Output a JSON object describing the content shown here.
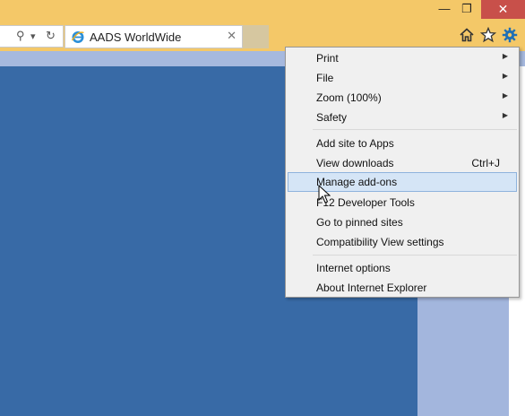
{
  "tab": {
    "title": "AADS WorldWide",
    "close": "✕"
  },
  "address": {
    "search_glyph": "⚲",
    "dropdown_glyph": "▾",
    "refresh_glyph": "↻"
  },
  "window": {
    "minimize": "—",
    "restore": "❐",
    "close": "✕"
  },
  "toolbar": {
    "icons": [
      "home-icon",
      "favorites-star-icon",
      "tools-gear-icon"
    ]
  },
  "menu": {
    "print": "Print",
    "file": "File",
    "zoom": "Zoom (100%)",
    "safety": "Safety",
    "add_site": "Add site to Apps",
    "view_downloads": "View downloads",
    "view_downloads_shortcut": "Ctrl+J",
    "manage_addons": "Manage add-ons",
    "f12": "F12 Developer Tools",
    "pinned": "Go to pinned sites",
    "compat": "Compatibility View settings",
    "internet_options": "Internet options",
    "about": "About Internet Explorer",
    "submenu_arrow": "▶"
  },
  "colors": {
    "titlebar": "#f4c868",
    "content": "#386aa6",
    "highlight": "#d5e5f6",
    "close": "#c8504a"
  }
}
